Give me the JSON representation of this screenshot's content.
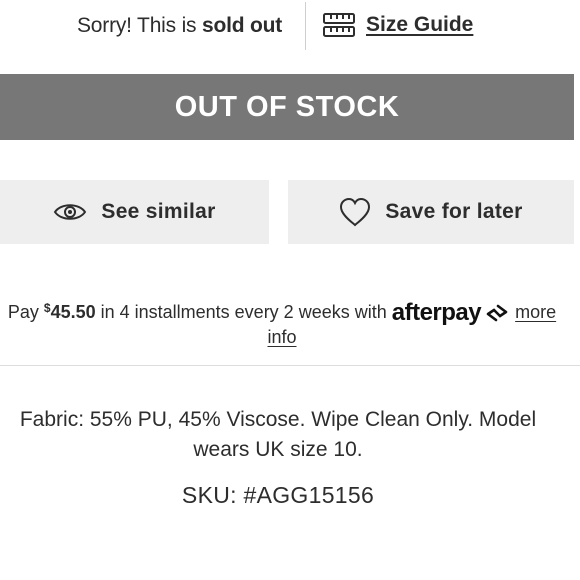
{
  "notice": {
    "prefix": "Sorry! This is ",
    "emphasis": "sold out"
  },
  "size_guide": {
    "icon": "ruler-icon",
    "label": "Size Guide"
  },
  "stock_button": {
    "label": "OUT OF STOCK",
    "color": "#777777"
  },
  "actions": {
    "similar": {
      "icon": "eye-icon",
      "label": "See similar"
    },
    "save": {
      "icon": "heart-icon",
      "label": "Save for later"
    }
  },
  "afterpay": {
    "pay_text": "Pay ",
    "currency": "$",
    "amount": "45.50",
    "middle_text": " in 4 installments every 2 weeks with ",
    "brand": "afterpay",
    "more_info": "more info"
  },
  "product": {
    "description": "Fabric: 55% PU, 45% Viscose. Wipe Clean Only. Model wears UK size 10.",
    "sku": "SKU: #AGG15156"
  }
}
